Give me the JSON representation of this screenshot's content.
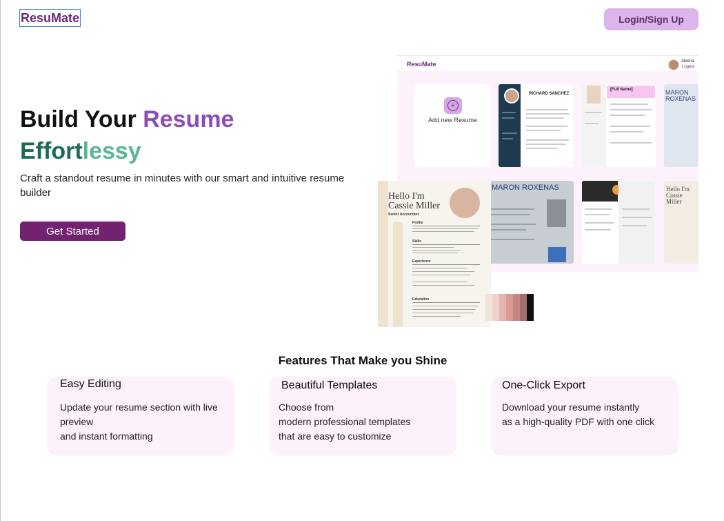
{
  "header": {
    "logo": "ResuMate",
    "login_label": "Login/Sign Up"
  },
  "hero": {
    "title_part1": "Build Your ",
    "title_part2": "Resume",
    "title_part3": "Effort",
    "title_part4": "lessy",
    "subtitle": "Craft a standout resume in minutes with our smart and intuitive resume builder",
    "cta_label": "Get Started"
  },
  "preview": {
    "logo": "ResuMate",
    "user_name": "Aleena",
    "logout_label": "Logout",
    "add_label": "Add new Resume",
    "templates": [
      {
        "name": "RICHARD SANCHEZ"
      },
      {
        "name": "[Full Name]"
      },
      {
        "name": "MARON ROXENAS"
      },
      {
        "name": "MARON ROXENAS"
      },
      {
        "name": "Hello I'm Cassie Miller"
      }
    ]
  },
  "featured_template": {
    "greeting": "Hello I'm",
    "name": "Cassie Miller",
    "role": "Senior Accountant",
    "sections": [
      "Profile",
      "Skills",
      "Experience",
      "Education"
    ]
  },
  "swatches": [
    "#efe4d9",
    "#f0d0cc",
    "#e6b3b0",
    "#d99a98",
    "#c68585",
    "#a67070",
    "#111111"
  ],
  "features": {
    "title": "Features That Make you Shine",
    "cards": [
      {
        "title": "Easy Editing",
        "body": "Update your resume section with live preview\nand instant formatting"
      },
      {
        "title": "Beautiful Templates",
        "body": "Choose from\nmodern professional templates\nthat are easy to customize"
      },
      {
        "title": "One-Click Export",
        "body": "Download your resume instantly\nas a high-quality PDF with one click"
      }
    ]
  }
}
